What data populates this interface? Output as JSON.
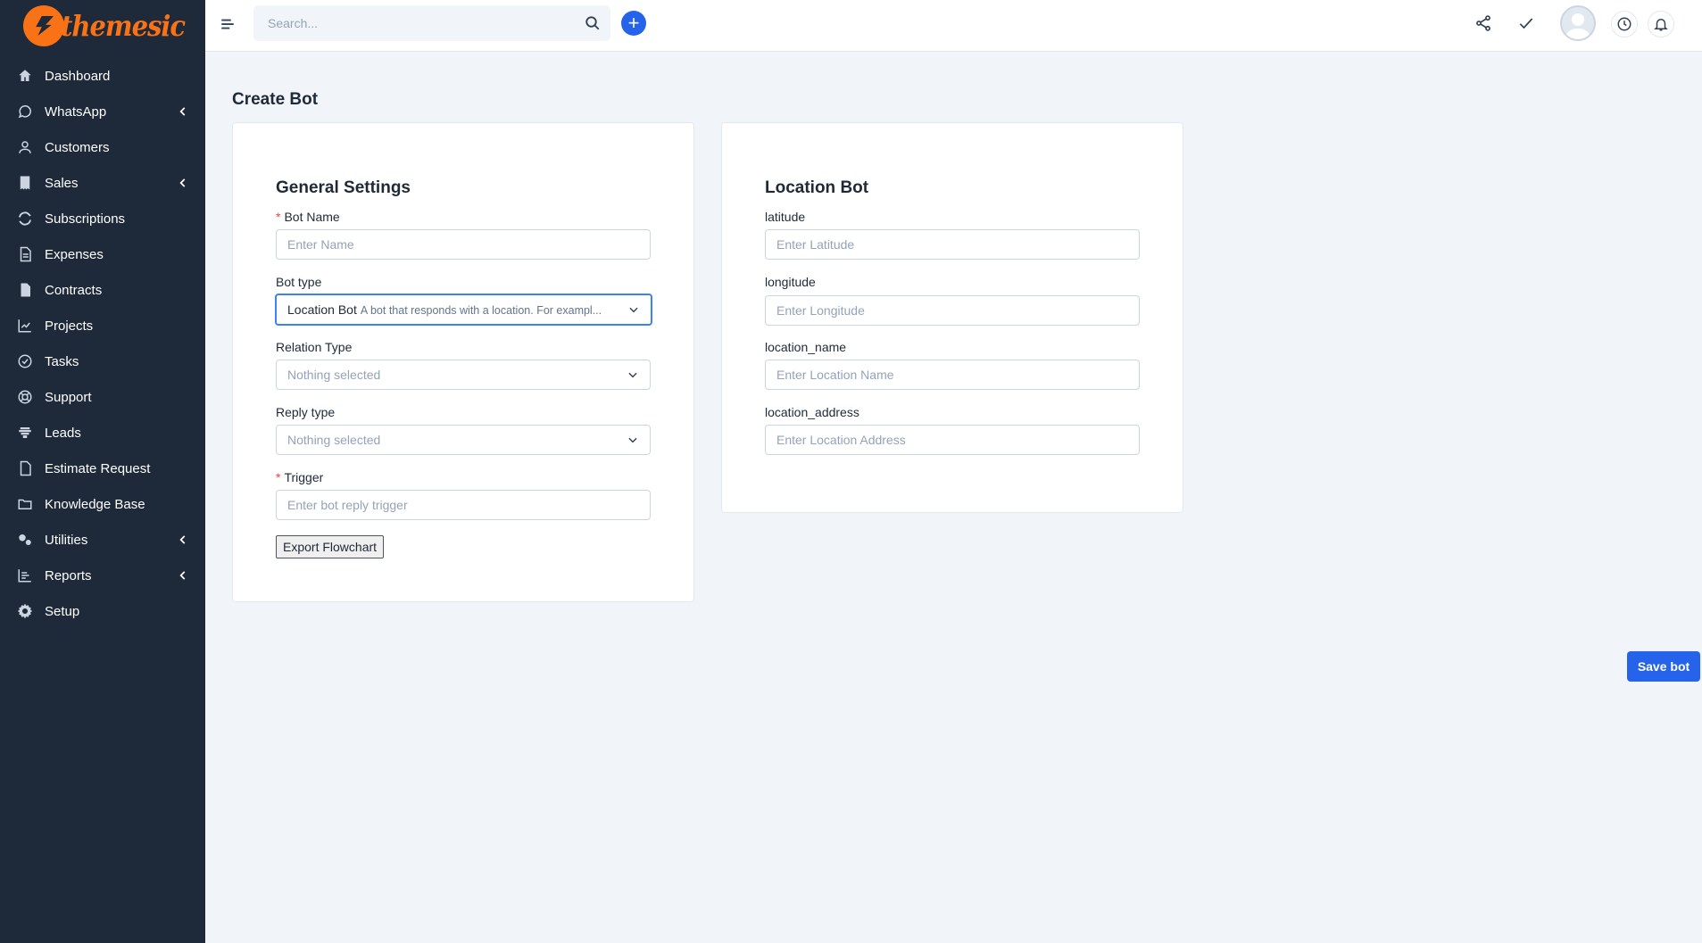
{
  "brand": {
    "name": "themesic",
    "color": "#f97316"
  },
  "sidebar": {
    "items": [
      {
        "label": "Dashboard",
        "icon": "home-icon",
        "has_submenu": false
      },
      {
        "label": "WhatsApp",
        "icon": "whatsapp-icon",
        "has_submenu": true
      },
      {
        "label": "Customers",
        "icon": "user-icon",
        "has_submenu": false
      },
      {
        "label": "Sales",
        "icon": "receipt-icon",
        "has_submenu": true
      },
      {
        "label": "Subscriptions",
        "icon": "refresh-icon",
        "has_submenu": false
      },
      {
        "label": "Expenses",
        "icon": "document-icon",
        "has_submenu": false
      },
      {
        "label": "Contracts",
        "icon": "contract-icon",
        "has_submenu": false
      },
      {
        "label": "Projects",
        "icon": "chart-icon",
        "has_submenu": false
      },
      {
        "label": "Tasks",
        "icon": "check-circle-icon",
        "has_submenu": false
      },
      {
        "label": "Support",
        "icon": "lifebuoy-icon",
        "has_submenu": false
      },
      {
        "label": "Leads",
        "icon": "leads-icon",
        "has_submenu": false
      },
      {
        "label": "Estimate Request",
        "icon": "file-icon",
        "has_submenu": false
      },
      {
        "label": "Knowledge Base",
        "icon": "folder-icon",
        "has_submenu": false
      },
      {
        "label": "Utilities",
        "icon": "cogs-icon",
        "has_submenu": true
      },
      {
        "label": "Reports",
        "icon": "bar-chart-icon",
        "has_submenu": true
      },
      {
        "label": "Setup",
        "icon": "gear-icon",
        "has_submenu": false
      }
    ]
  },
  "header": {
    "search_placeholder": "Search...",
    "accent": "#2563eb"
  },
  "page": {
    "title": "Create Bot",
    "general": {
      "heading": "General Settings",
      "bot_name_label": "Bot Name",
      "bot_name_placeholder": "Enter Name",
      "bot_type_label": "Bot type",
      "bot_type_value": "Location Bot",
      "bot_type_desc": "A bot that responds with a location. For exampl...",
      "relation_type_label": "Relation Type",
      "relation_type_value": "Nothing selected",
      "reply_type_label": "Reply type",
      "reply_type_value": "Nothing selected",
      "trigger_label": "Trigger",
      "trigger_placeholder": "Enter bot reply trigger",
      "export_label": "Export Flowchart"
    },
    "location": {
      "heading": "Location Bot",
      "latitude_label": "latitude",
      "latitude_placeholder": "Enter Latitude",
      "longitude_label": "longitude",
      "longitude_placeholder": "Enter Longitude",
      "name_label": "location_name",
      "name_placeholder": "Enter Location Name",
      "address_label": "location_address",
      "address_placeholder": "Enter Location Address"
    },
    "save_label": "Save bot"
  }
}
